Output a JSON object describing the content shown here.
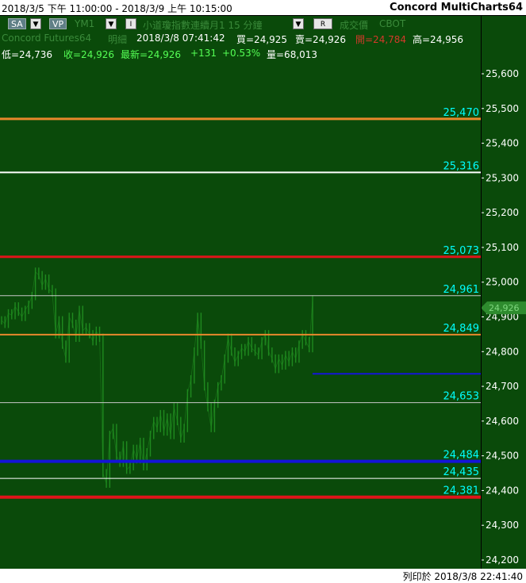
{
  "header": {
    "date_range": "2018/3/5 下午 11:00:00 - 2018/3/9 上午 10:15:00",
    "app_title": "Concord MultiCharts64"
  },
  "toolbar": {
    "sa_label": "SA",
    "vp_label": "VP",
    "symbol": "YM1",
    "description": "小道瓊指數連續月1  15 分鐘",
    "chart_style": "成交價",
    "exchange": "CBOT",
    "dropdown_glyph": "▼",
    "interval_label": "I",
    "r_label": "R"
  },
  "info": {
    "datafeed": "Concord Futures64",
    "detail_label": "明細",
    "date_time": "2018/3/8  07:41:42",
    "bid": "買=24,925",
    "ask": "賣=24,926",
    "open": "開=24,784",
    "high": "高=24,956",
    "low": "低=24,736",
    "close": "收=24,926",
    "last": "最新=24,926",
    "change": "+131",
    "change_pct": "+0.53%",
    "volume": "量=68,013"
  },
  "footer": {
    "printed_at": "列印於 2018/3/8 22:41:40"
  },
  "colors": {
    "background": "#0a4a0a",
    "bars": "#1f8a1f",
    "axis_text": "#ffffff",
    "level_label": "#00ffff",
    "orange": "#e8882c",
    "red": "#e0141a",
    "blue": "#1414d8",
    "white": "#ffffff",
    "gray": "#c8c8c8",
    "price_marker": "#2e8b2e"
  },
  "chart_data": {
    "type": "line",
    "title": "",
    "xlabel": "",
    "ylabel": "",
    "ylim": [
      24200,
      25600
    ],
    "y_ticks": [
      "25,600",
      "25,500",
      "25,400",
      "25,300",
      "25,200",
      "25,100",
      "25,000",
      "24,900",
      "24,800",
      "24,700",
      "24,600",
      "24,500",
      "24,400",
      "24,300",
      "24,200"
    ],
    "y_tick_values": [
      25600,
      25500,
      25400,
      25300,
      25200,
      25100,
      25000,
      24900,
      24800,
      24700,
      24600,
      24500,
      24400,
      24300,
      24200
    ],
    "current_price": 24926,
    "current_price_label": "24,926",
    "series": [
      {
        "values": [
          24890,
          24880,
          24910,
          24905,
          24930,
          24915,
          24900,
          24920,
          24935,
          24960,
          25030,
          25020,
          24990,
          25010,
          24980,
          24970,
          24850,
          24890,
          24820,
          24780,
          24900,
          24880,
          24840,
          24920,
          24860,
          24870,
          24850,
          24830,
          24860,
          24840,
          24450,
          24420,
          24560,
          24580,
          24500,
          24480,
          24530,
          24460,
          24470,
          24520,
          24490,
          24540,
          24470,
          24510,
          24560,
          24600,
          24580,
          24620,
          24570,
          24610,
          24560,
          24640,
          24600,
          24550,
          24580,
          24680,
          24720,
          24800,
          24900,
          24820,
          24700,
          24640,
          24580,
          24650,
          24700,
          24720,
          24780,
          24840,
          24800,
          24770,
          24790,
          24810,
          24800,
          24830,
          24810,
          24800,
          24790,
          24830,
          24850,
          24800,
          24780,
          24750,
          24780,
          24760,
          24790,
          24770,
          24800,
          24780,
          24820,
          24850,
          24830,
          24810,
          24950
        ]
      }
    ],
    "levels": [
      {
        "value": 25470,
        "label": "25,470",
        "color": "#e8882c",
        "width": 3,
        "start": 0
      },
      {
        "value": 25316,
        "label": "25,316",
        "color": "#ffffff",
        "width": 2,
        "start": 0
      },
      {
        "value": 25073,
        "label": "25,073",
        "color": "#e0141a",
        "width": 3,
        "start": 0
      },
      {
        "value": 24961,
        "label": "24,961",
        "color": "#c8c8c8",
        "width": 1,
        "start": 0
      },
      {
        "value": 24849,
        "label": "24,849",
        "color": "#e8882c",
        "width": 2,
        "start": 0
      },
      {
        "value": 24736,
        "label": "",
        "color": "#1414d8",
        "width": 2,
        "start": 0.65
      },
      {
        "value": 24653,
        "label": "24,653",
        "color": "#c8c8c8",
        "width": 1,
        "start": 0
      },
      {
        "value": 24484,
        "label": "24,484",
        "color": "#1414d8",
        "width": 4,
        "start": 0
      },
      {
        "value": 24435,
        "label": "24,435",
        "color": "#ffffff",
        "width": 1,
        "start": 0
      },
      {
        "value": 24381,
        "label": "24,381",
        "color": "#e0141a",
        "width": 4,
        "start": 0
      }
    ]
  }
}
